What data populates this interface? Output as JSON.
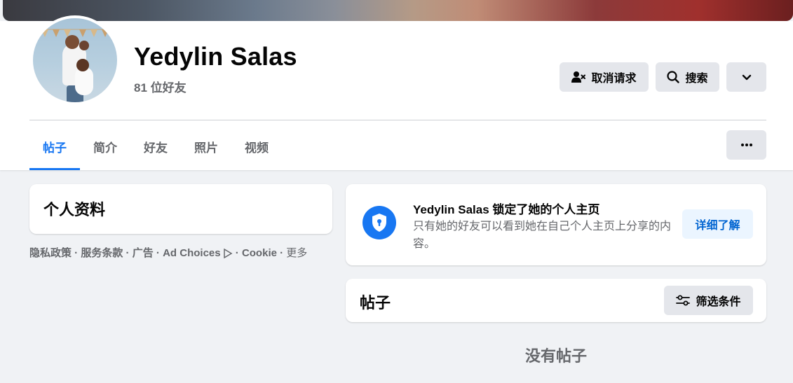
{
  "profile": {
    "name": "Yedylin Salas",
    "friends_count": "81 位好友"
  },
  "actions": {
    "cancel_request": "取消请求",
    "search": "搜索",
    "more_icon": "chevron-down-icon",
    "dots_icon": "more-horizontal-icon"
  },
  "tabs": [
    {
      "label": "帖子",
      "active": true
    },
    {
      "label": "简介",
      "active": false
    },
    {
      "label": "好友",
      "active": false
    },
    {
      "label": "照片",
      "active": false
    },
    {
      "label": "视频",
      "active": false
    }
  ],
  "intro": {
    "title": "个人资料"
  },
  "footer": {
    "privacy": "隐私政策",
    "terms": "服务条款",
    "ads": "广告",
    "ad_choices": "Ad Choices",
    "cookie": "Cookie",
    "more": "更多",
    "separator": " · "
  },
  "locked_notice": {
    "title": "Yedylin Salas 锁定了她的个人主页",
    "description": "只有她的好友可以看到她在自己个人主页上分享的内容。",
    "learn_more": "详细了解"
  },
  "posts": {
    "title": "帖子",
    "filter": "筛选条件",
    "empty_text": "没有帖子"
  },
  "colors": {
    "accent": "#1877f2",
    "background": "#f0f2f5",
    "button_gray": "#e4e6eb",
    "secondary_text": "#65676b"
  }
}
